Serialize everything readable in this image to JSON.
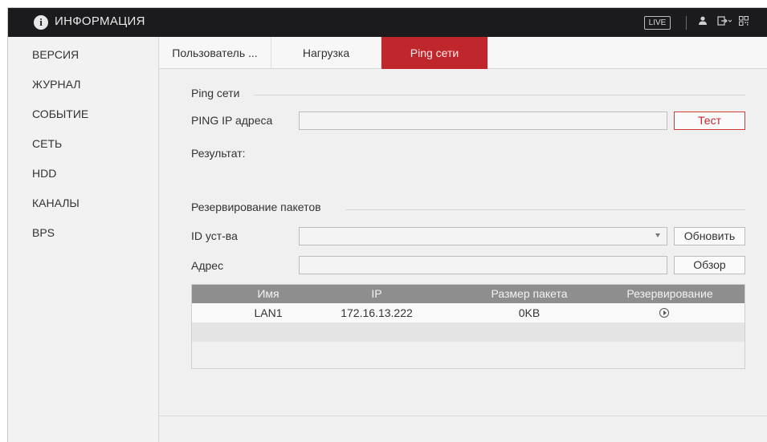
{
  "header": {
    "info_icon": "i",
    "title": "ИНФОРМАЦИЯ",
    "live_label": "LIVE",
    "icons": [
      "user-icon",
      "logout-icon",
      "qr-code-icon"
    ]
  },
  "sidebar": {
    "items": [
      {
        "label": "ВЕРСИЯ"
      },
      {
        "label": "ЖУРНАЛ"
      },
      {
        "label": "СОБЫТИЕ"
      },
      {
        "label": "СЕТЬ"
      },
      {
        "label": "HDD"
      },
      {
        "label": "КАНАЛЫ"
      },
      {
        "label": "BPS"
      }
    ]
  },
  "tabs": [
    {
      "label": "Пользователь ..."
    },
    {
      "label": "Нагрузка"
    },
    {
      "label": "Ping сети",
      "active": true
    }
  ],
  "ping": {
    "section_title": "Ping сети",
    "ip_label": "PING IP адреса",
    "ip_value": "",
    "test_button": "Тест",
    "result_label": "Результат:"
  },
  "backup": {
    "section_title": "Резервирование пакетов",
    "device_label": "ID уст-ва",
    "device_value": "",
    "refresh_button": "Обновить",
    "address_label": "Адрес",
    "address_value": "",
    "browse_button": "Обзор",
    "table": {
      "headers": [
        "Имя",
        "IP",
        "Размер пакета",
        "Резервирование"
      ],
      "rows": [
        {
          "name": "LAN1",
          "ip": "172.16.13.222",
          "size": "0KB",
          "action_icon": "play-circle-icon"
        }
      ]
    }
  },
  "colors": {
    "accent": "#c0272d",
    "topbar": "#1b1b1d",
    "table_header": "#8e8e8e"
  }
}
